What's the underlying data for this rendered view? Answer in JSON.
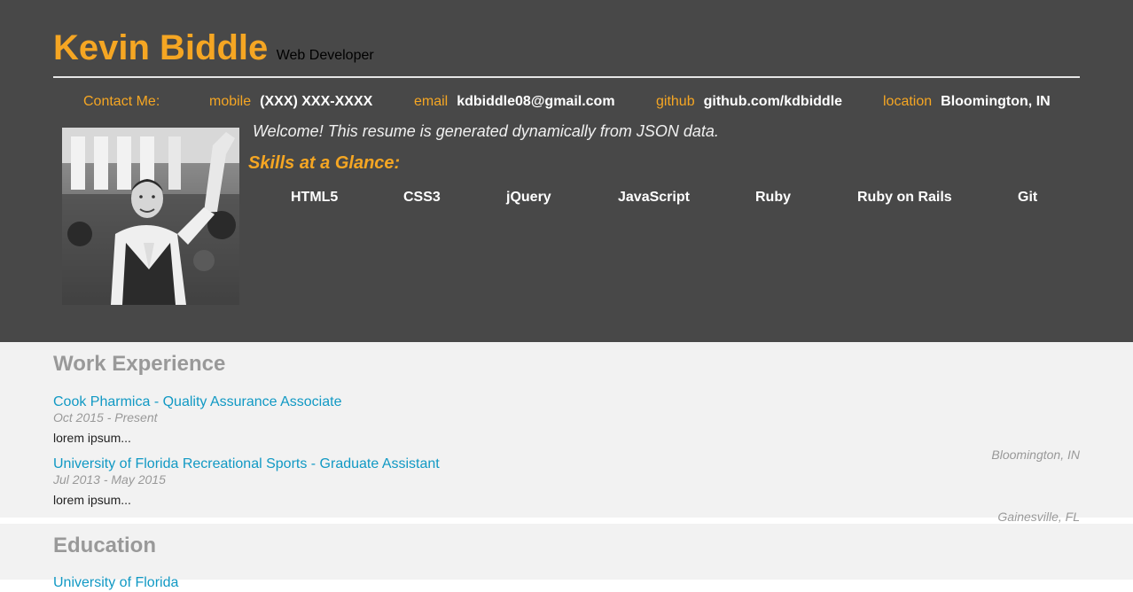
{
  "header": {
    "name": "Kevin Biddle",
    "role": "Web Developer",
    "contact_heading": "Contact Me:",
    "contacts": [
      {
        "label": "mobile",
        "value": "(XXX) XXX-XXXX"
      },
      {
        "label": "email",
        "value": "kdbiddle08@gmail.com"
      },
      {
        "label": "github",
        "value": "github.com/kdbiddle"
      },
      {
        "label": "location",
        "value": "Bloomington, IN"
      }
    ],
    "welcome_message": "Welcome! This resume is generated dynamically from JSON data.",
    "skills_heading": "Skills at a Glance:",
    "skills": [
      "HTML5",
      "CSS3",
      "jQuery",
      "JavaScript",
      "Ruby",
      "Ruby on Rails",
      "Git"
    ]
  },
  "work": {
    "heading": "Work Experience",
    "jobs": [
      {
        "title": "Cook Pharmica - Quality Assurance Associate",
        "dates": "Oct 2015 - Present",
        "location": "Bloomington, IN",
        "description": "lorem ipsum..."
      },
      {
        "title": "University of Florida Recreational Sports - Graduate Assistant",
        "dates": "Jul 2013 - May 2015",
        "location": "Gainesville, FL",
        "description": "lorem ipsum..."
      }
    ]
  },
  "education": {
    "heading": "Education",
    "schools": [
      {
        "name": "University of Florida"
      }
    ]
  },
  "colors": {
    "header_background": "#484848",
    "accent_orange": "#f5a623",
    "link_blue": "#1199c4",
    "section_background": "#f2f2f2",
    "muted_gray": "#999999"
  }
}
